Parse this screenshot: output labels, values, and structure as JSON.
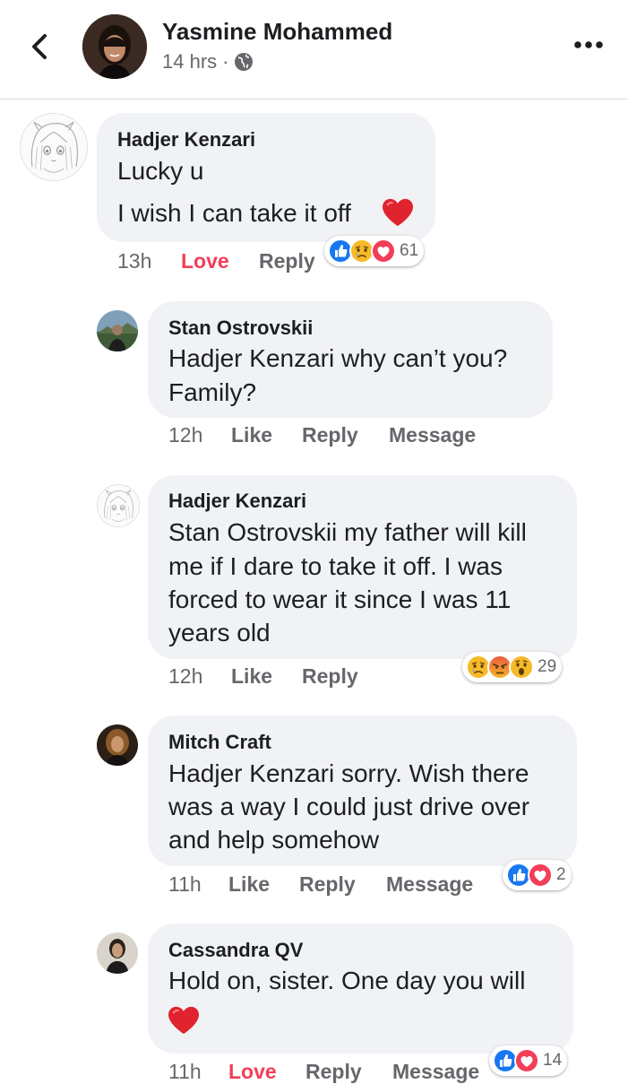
{
  "header": {
    "name": "Yasmine Mohammed",
    "time": "14 hrs",
    "dot": "·"
  },
  "comments": [
    {
      "author": "Hadjer Kenzari",
      "lines": [
        "Lucky u",
        "I wish I can take it off"
      ],
      "time": "13h",
      "actions": [
        "Love",
        "Reply"
      ],
      "reactions": [
        "like",
        "sad",
        "love"
      ],
      "reaction_count": "61"
    },
    {
      "author": "Stan Ostrovskii",
      "lines": [
        "Hadjer Kenzari why can’t you?",
        "Family?"
      ],
      "time": "12h",
      "actions": [
        "Like",
        "Reply",
        "Message"
      ]
    },
    {
      "author": "Hadjer Kenzari",
      "lines": [
        "Stan Ostrovskii my father will kill",
        "me if I dare to take it off. I was",
        "forced to wear it since I was 11",
        "years old"
      ],
      "time": "12h",
      "actions": [
        "Like",
        "Reply"
      ],
      "reactions": [
        "sad",
        "angry",
        "wow"
      ],
      "reaction_count": "29"
    },
    {
      "author": "Mitch Craft",
      "lines": [
        "Hadjer Kenzari sorry. Wish there",
        "was a way I could just drive over",
        "and help somehow"
      ],
      "time": "11h",
      "actions": [
        "Like",
        "Reply",
        "Message"
      ],
      "reactions": [
        "like",
        "love"
      ],
      "reaction_count": "2"
    },
    {
      "author": "Cassandra QV",
      "lines": [
        "Hold on, sister. One day you will"
      ],
      "time": "11h",
      "actions": [
        "Love",
        "Reply",
        "Message"
      ],
      "reactions": [
        "like",
        "love"
      ],
      "reaction_count": "14"
    }
  ],
  "colors": {
    "bubble": "#f0f2f5",
    "love_action": "#f33e58",
    "like_blue": "#1877f2",
    "love_red": "#f33e58",
    "reaction_yellow": "#f7b928",
    "meta_gray": "#65676b"
  },
  "icons": [
    "back-arrow-icon",
    "globe-icon",
    "more-options-icon",
    "heart-emoji-icon"
  ]
}
